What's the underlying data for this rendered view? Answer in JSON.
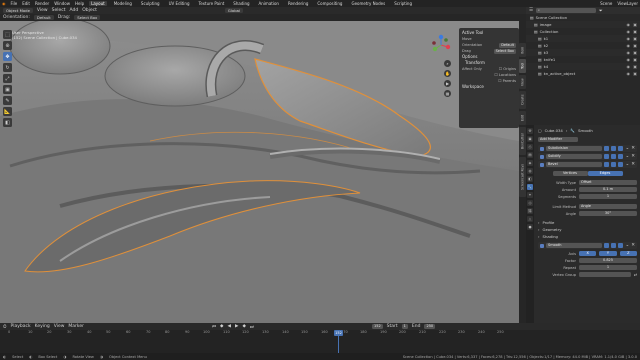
{
  "menubar": {
    "menus": [
      "File",
      "Edit",
      "Render",
      "Window",
      "Help"
    ],
    "workspaces": [
      "Layout",
      "Modeling",
      "Sculpting",
      "UV Editing",
      "Texture Paint",
      "Shading",
      "Animation",
      "Rendering",
      "Compositing",
      "Geometry Nodes",
      "Scripting"
    ],
    "active_workspace": "Layout",
    "scene": "Scene",
    "view_layer": "ViewLayer"
  },
  "viewport_header": {
    "mode": "Object Mode",
    "menus": [
      "View",
      "Select",
      "Add",
      "Object"
    ],
    "orientation_label": "Orientation:",
    "orientation_value": "Default",
    "drag_label": "Drag:",
    "drag_value": "Select Box",
    "transform_value": "Global"
  },
  "viewport": {
    "info_line1": "User Perspective",
    "info_line2": "(152) Scene Collection | Cube.034",
    "colors": {
      "background": "#6f6f6f",
      "surface_light": "#9a9a9a",
      "surface_dark": "#5c5c5c",
      "selection_outline": "#e0903a"
    }
  },
  "toolbar": {
    "tools": [
      "select-box-icon",
      "cursor-icon",
      "move-icon",
      "rotate-icon",
      "scale-icon",
      "transform-icon",
      "annotate-icon",
      "measure-icon",
      "add-cube-icon"
    ],
    "active_index": 2
  },
  "npanel": {
    "active_tool_title": "Active Tool",
    "move_label": "Move",
    "orientation_label": "Orientation",
    "orientation_value": "Default",
    "drag_label": "Drag",
    "drag_value": "Select Box",
    "options_title": "Options",
    "transform_title": "Transform",
    "affect_only_label": "Affect Only",
    "origins_label": "Origins",
    "locations_label": "Locations",
    "parents_label": "Parents",
    "workspace_title": "Workspace",
    "tabs": [
      "Item",
      "Tool",
      "View",
      "Create",
      "Edit",
      "BoxCutter",
      "Screencast Keys"
    ]
  },
  "outliner": {
    "title": "Scene Collection",
    "rows": [
      {
        "label": "Scene Collection"
      },
      {
        "label": "image"
      },
      {
        "label": "Collection"
      },
      {
        "label": "k1"
      },
      {
        "label": "k2"
      },
      {
        "label": "k3"
      },
      {
        "label": "knife1"
      },
      {
        "label": "k4"
      },
      {
        "label": "kn_active_object"
      }
    ]
  },
  "properties": {
    "object_name": "Cube.034",
    "data_name": "Smooth",
    "add_modifier_label": "Add Modifier",
    "modifiers": [
      "Subdivision",
      "Solidify",
      "Bevel"
    ],
    "vertices_label": "Vertices",
    "edges_label": "Edges",
    "width_type_label": "Width Type",
    "width_type_value": "Offset",
    "amount_label": "Amount",
    "amount_value": "0.1 m",
    "segments_label": "Segments",
    "segments_value": "1",
    "limit_method_label": "Limit Method",
    "limit_method_value": "Angle",
    "angle_label": "Angle",
    "angle_value": "30°",
    "profile_label": "Profile",
    "geometry_label": "Geometry",
    "shading_label": "Shading",
    "smooth_mod_label": "Smooth",
    "axis_label": "Axis",
    "axis_values": [
      "X",
      "Y",
      "Z"
    ],
    "factor_label": "Factor",
    "factor_value": "0.825",
    "repeat_label": "Repeat",
    "repeat_value": "1",
    "vertex_group_label": "Vertex Group"
  },
  "timeline": {
    "menus": [
      "Playback",
      "Keying",
      "View",
      "Marker"
    ],
    "current_frame": "152",
    "start_label": "Start",
    "start_value": "1",
    "end_label": "End",
    "end_value": "250",
    "ticks": [
      "0",
      "10",
      "20",
      "30",
      "40",
      "50",
      "60",
      "70",
      "80",
      "90",
      "100",
      "110",
      "120",
      "130",
      "140",
      "150",
      "160",
      "170",
      "180",
      "190",
      "200",
      "210",
      "220",
      "230",
      "240",
      "250"
    ],
    "playhead_value": "152"
  },
  "statusbar": {
    "select_label": "Select",
    "box_select_label": "Box Select",
    "rotate_view_label": "Rotate View",
    "context_menu_label": "Object Context Menu",
    "stats": "Scene Collection | Cube.034 | Verts:6,337 | Faces:6,278 | Tris:12,556 | Objects:1/17 | Memory: 44.0 MiB | VRAM: 1.1/4.0 GiB | 3.0.0"
  }
}
